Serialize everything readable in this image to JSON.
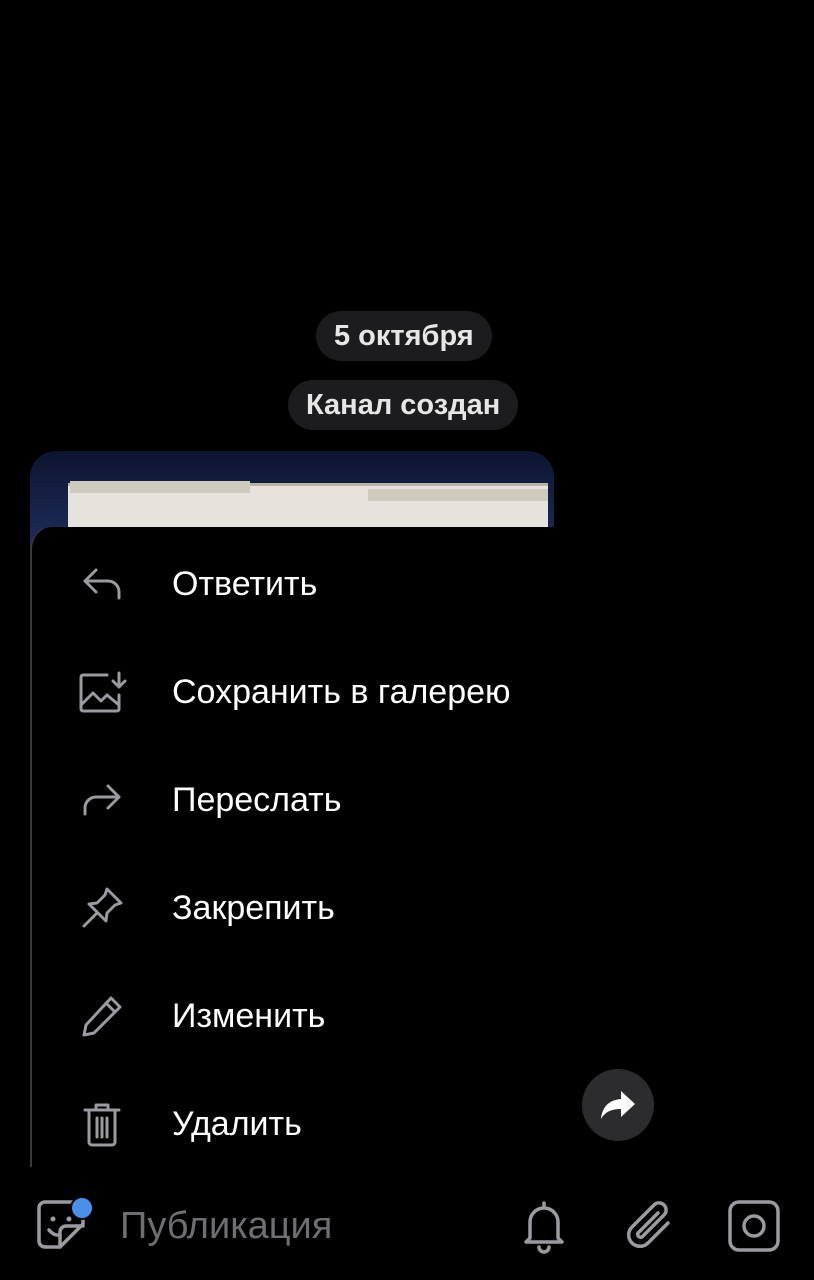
{
  "chat": {
    "date_label": "5 октября",
    "service_message": "Канал создан"
  },
  "context_menu": {
    "items": [
      {
        "label": "Ответить",
        "icon": "reply-icon"
      },
      {
        "label": "Сохранить в галерею",
        "icon": "save-to-gallery-icon"
      },
      {
        "label": "Переслать",
        "icon": "forward-icon"
      },
      {
        "label": "Закрепить",
        "icon": "pin-icon"
      },
      {
        "label": "Изменить",
        "icon": "edit-pencil-icon"
      },
      {
        "label": "Удалить",
        "icon": "trash-icon"
      }
    ]
  },
  "composer": {
    "placeholder": "Публикация"
  },
  "colors": {
    "accent": "#4a8fe8",
    "pill_bg": "#1c1c1e",
    "icon_gray": "#9a9aa0"
  }
}
